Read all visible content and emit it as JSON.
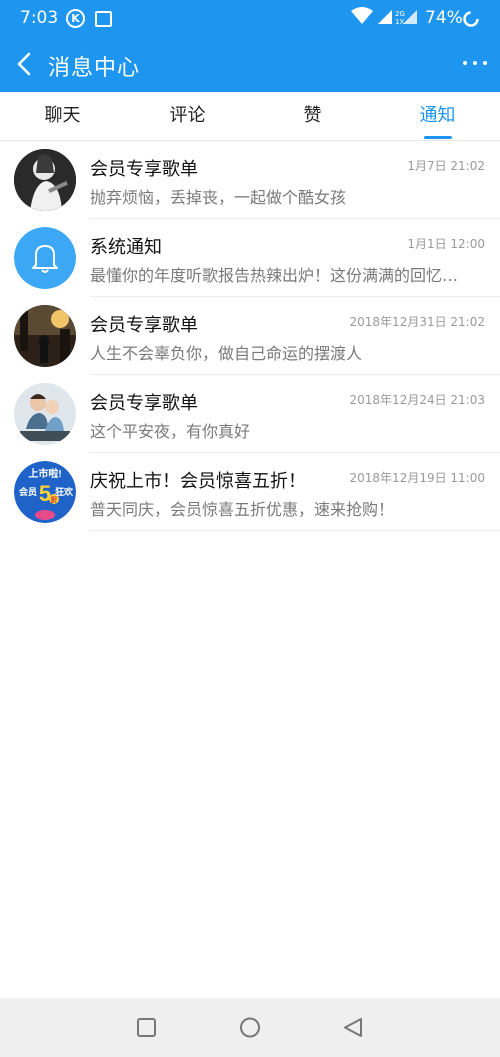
{
  "status_bar": {
    "time": "7:03",
    "battery": "74%"
  },
  "app_bar": {
    "title": "消息中心"
  },
  "tabs": [
    {
      "label": "聊天",
      "active": false
    },
    {
      "label": "评论",
      "active": false
    },
    {
      "label": "赞",
      "active": false
    },
    {
      "label": "通知",
      "active": true
    }
  ],
  "messages": [
    {
      "title": "会员专享歌单",
      "time": "1月7日 21:02",
      "snippet": "抛弃烦恼，丢掉丧，一起做个酷女孩",
      "avatar": "girl-photo"
    },
    {
      "title": "系统通知",
      "time": "1月1日 12:00",
      "snippet": "最懂你的年度听歌报告热辣出炉！这份满满的回忆…",
      "avatar": "bell-icon"
    },
    {
      "title": "会员专享歌单",
      "time": "2018年12月31日 21:02",
      "snippet": "人生不会辜负你，做自己命运的摆渡人",
      "avatar": "street-photo"
    },
    {
      "title": "会员专享歌单",
      "time": "2018年12月24日 21:03",
      "snippet": "这个平安夜，有你真好",
      "avatar": "couple-photo"
    },
    {
      "title": "庆祝上市！会员惊喜五折！",
      "time": "2018年12月19日 11:00",
      "snippet": "普天同庆，会员惊喜五折优惠，速来抢购！",
      "avatar": "promo-badge",
      "avatar_text": {
        "line1": "上市啦!",
        "line2": "会员",
        "line3": "5",
        "line4": "折",
        "line5": "狂欢"
      }
    }
  ],
  "colors": {
    "accent": "#1e96f0",
    "text": "#111111",
    "subtext": "#7a7a7a",
    "time": "#9a9a9a"
  }
}
